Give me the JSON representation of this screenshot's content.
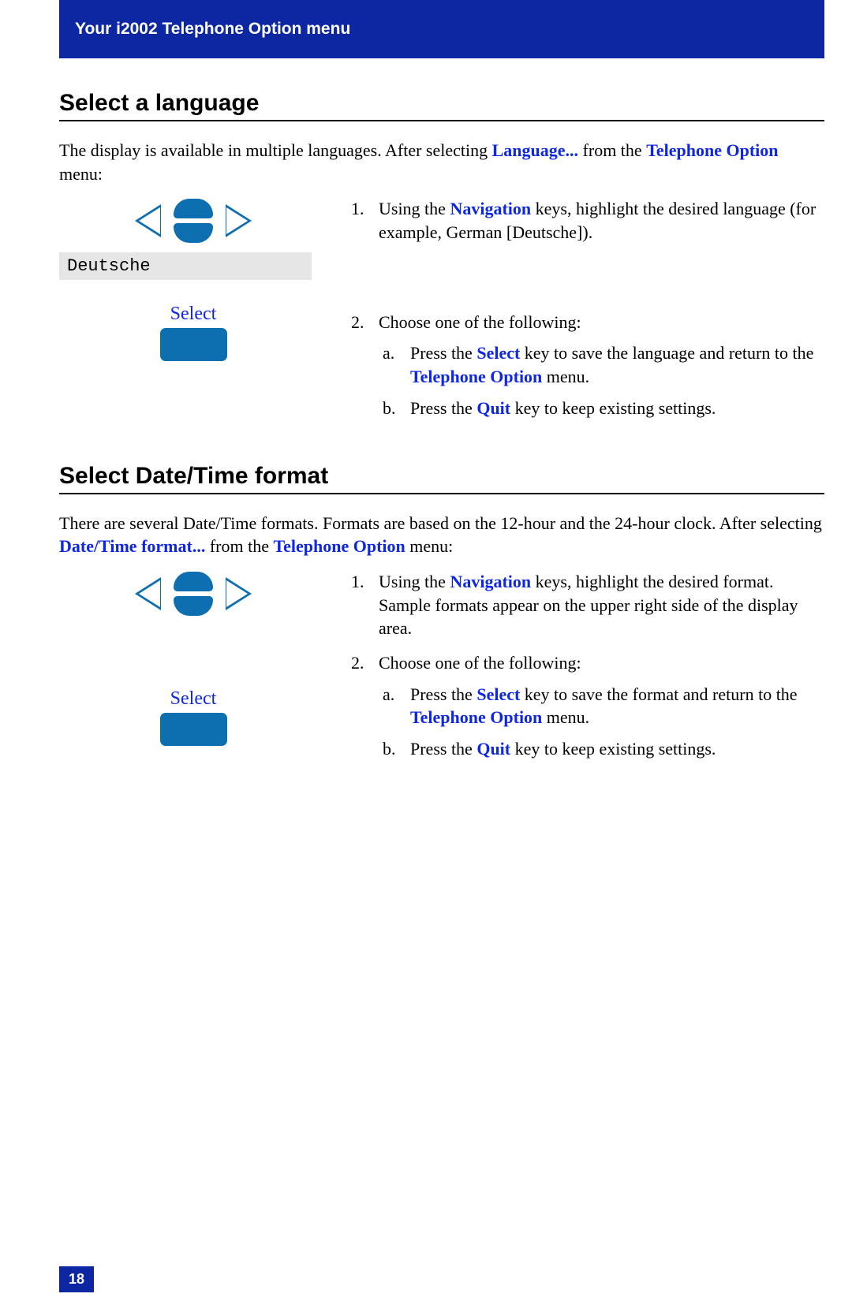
{
  "header": {
    "title": "Your i2002 Telephone Option menu"
  },
  "section1": {
    "title": "Select a language",
    "intro_pre": "The display is available in multiple languages. After selecting ",
    "ref1": "Language...",
    "intro_mid": " from the ",
    "ref2": "Telephone Option",
    "intro_post": " menu:",
    "display_value": "Deutsche",
    "select_label": "Select",
    "step1": {
      "num": "1.",
      "pre": "Using the ",
      "ref": "Navigation",
      "post": " keys, highlight the desired language (for example, German [Deutsche])."
    },
    "step2": {
      "num": "2.",
      "text": "Choose one of the following:",
      "a": {
        "label": "a.",
        "pre": "Press the ",
        "ref1": "Select",
        "mid": " key to save the language and return to the ",
        "ref2": "Telephone Option",
        "post": " menu."
      },
      "b": {
        "label": "b.",
        "pre": "Press the ",
        "ref": "Quit",
        "post": " key to keep existing settings."
      }
    }
  },
  "section2": {
    "title": "Select Date/Time format",
    "intro_pre": "There are several Date/Time formats. Formats are based on the 12-hour and the 24-hour clock. After selecting ",
    "ref1": "Date/Time format...",
    "intro_mid": " from the ",
    "ref2": "Telephone Option",
    "intro_post": " menu:",
    "select_label": "Select",
    "step1": {
      "num": "1.",
      "pre": "Using the ",
      "ref": "Navigation",
      "post": " keys, highlight the desired format. Sample formats appear on the upper right side of the display area."
    },
    "step2": {
      "num": "2.",
      "text": "Choose one of the following:",
      "a": {
        "label": "a.",
        "pre": "Press the ",
        "ref1": "Select",
        "mid": " key to save the format and return to the ",
        "ref2": "Telephone Option",
        "post": " menu."
      },
      "b": {
        "label": "b.",
        "pre": "Press the ",
        "ref": "Quit",
        "post": " key to keep existing settings."
      }
    }
  },
  "page_number": "18"
}
